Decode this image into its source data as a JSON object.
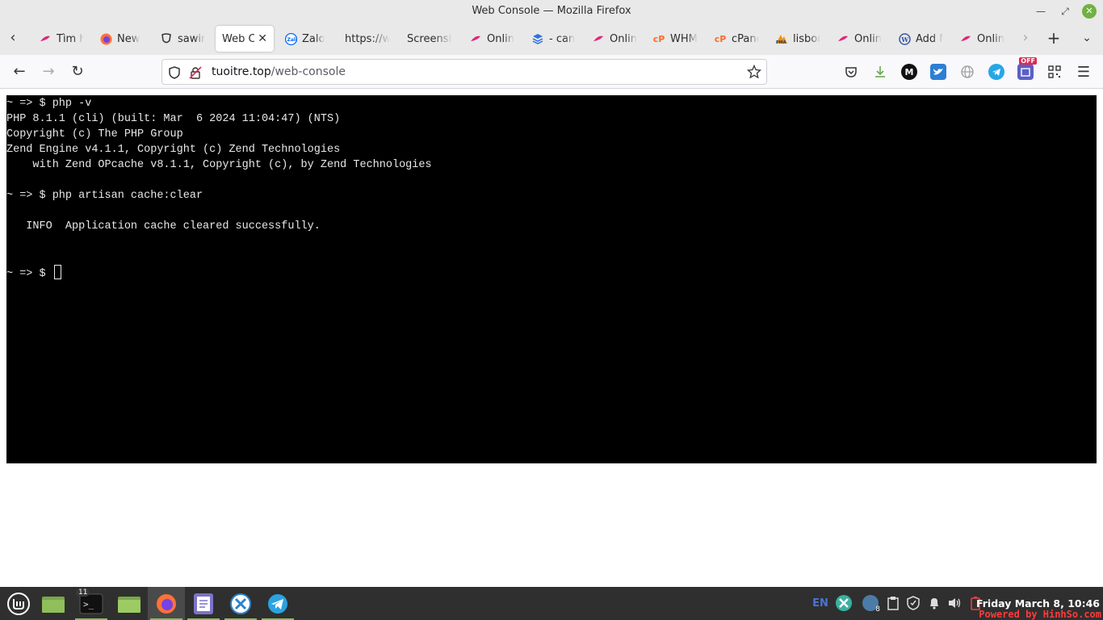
{
  "window": {
    "title": "Web Console — Mozilla Firefox"
  },
  "tabs": [
    {
      "label": "Tìm h",
      "icon": "pink-brand-icon"
    },
    {
      "label": "New",
      "icon": "firefox-icon"
    },
    {
      "label": "sawin",
      "icon": "mask-icon"
    },
    {
      "label": "Web C",
      "icon": "none",
      "active": true
    },
    {
      "label": "Zalo",
      "icon": "zalo-icon"
    },
    {
      "label": "https://w",
      "icon": "none"
    },
    {
      "label": "Screensh",
      "icon": "none"
    },
    {
      "label": "Onlin",
      "icon": "pink-brand-icon"
    },
    {
      "label": "- can",
      "icon": "stack-icon"
    },
    {
      "label": "Onlin",
      "icon": "pink-brand-icon"
    },
    {
      "label": "WHM",
      "icon": "cpanel-icon"
    },
    {
      "label": "cPane",
      "icon": "cpanel-icon"
    },
    {
      "label": "lisbor",
      "icon": "phpmyadmin-icon"
    },
    {
      "label": "Onlin",
      "icon": "pink-brand-icon"
    },
    {
      "label": "Add N",
      "icon": "wordpress-icon"
    },
    {
      "label": "Onlin",
      "icon": "pink-brand-icon"
    }
  ],
  "url": {
    "host": "tuoitre.top",
    "path": "/web-console"
  },
  "toolbar": {
    "ext_badge": "OFF"
  },
  "console": {
    "lines": [
      "~ => $ php -v",
      "PHP 8.1.1 (cli) (built: Mar  6 2024 11:04:47) (NTS)",
      "Copyright (c) The PHP Group",
      "Zend Engine v4.1.1, Copyright (c) Zend Technologies",
      "    with Zend OPcache v8.1.1, Copyright (c), by Zend Technologies",
      "",
      "~ => $ php artisan cache:clear",
      "",
      "   INFO  Application cache cleared successfully.",
      "",
      ""
    ],
    "prompt": "~ => $ "
  },
  "taskbar": {
    "terminal_badge": "11",
    "lang": "EN",
    "weather_badge": "8",
    "clock": "Friday March  8, 10:46",
    "watermark": "Powered by HinhSo.com"
  },
  "colors": {
    "console_bg": "#000000",
    "console_fg": "#e8e8e8",
    "taskbar_bg": "#2f2f2f",
    "mint_green": "#8fb765"
  }
}
